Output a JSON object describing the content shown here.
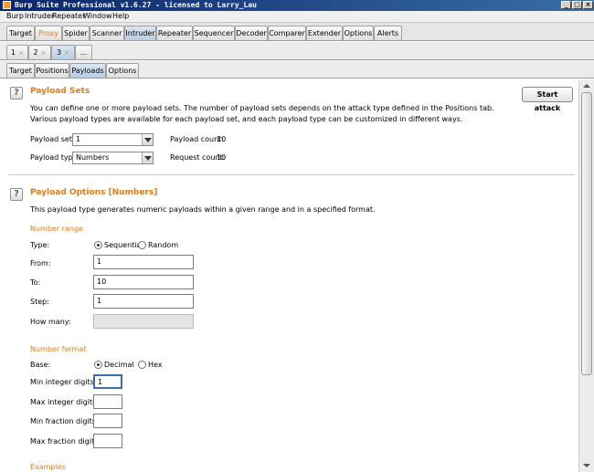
{
  "window": {
    "title": "Burp Suite Professional v1.6.27 - licensed to Larry_Lau",
    "icon": "burp-icon",
    "controls": [
      "_",
      "□",
      "×"
    ]
  },
  "menubar": [
    "Burp",
    "Intruder",
    "Repeater",
    "Window",
    "Help"
  ],
  "main_tabs": [
    "Target",
    "Proxy",
    "Spider",
    "Scanner",
    "Intruder",
    "Repeater",
    "Sequencer",
    "Decoder",
    "Comparer",
    "Extender",
    "Options",
    "Alerts"
  ],
  "main_tab_active": "Intruder",
  "proxy_tab_color": "#e07b1a",
  "attack_tabs": [
    "1",
    "2",
    "3",
    "..."
  ],
  "attack_tab_close": "×",
  "sub_tabs": [
    "Target",
    "Positions",
    "Payloads",
    "Options"
  ],
  "sub_tab_active": "Payloads",
  "payload_sets": {
    "heading": "Payload Sets",
    "description": "You can define one or more payload sets. The number of payload sets depends on the attack type defined in the Positions tab. Various payload types are available for each payload set, and each payload type can be customized in different ways.",
    "start_attack": "Start attack",
    "payload_set_label": "Payload set:",
    "payload_set_value": "1",
    "payload_type_label": "Payload type:",
    "payload_type_value": "Numbers",
    "payload_count_label": "Payload count:",
    "payload_count_value": "10",
    "request_count_label": "Request count:",
    "request_count_value": "10",
    "help_icon": "?"
  },
  "payload_options": {
    "heading": "Payload Options [Numbers]",
    "description": "This payload type generates numeric payloads within a given range and in a specified format.",
    "help_icon": "?",
    "number_range": {
      "heading": "Number range",
      "type_label": "Type:",
      "sequential": "Sequential",
      "random": "Random",
      "from_label": "From:",
      "from_value": "1",
      "to_label": "To:",
      "to_value": "10",
      "step_label": "Step:",
      "step_value": "1",
      "how_many_label": "How many:",
      "how_many_value": ""
    },
    "number_format": {
      "heading": "Number format",
      "base_label": "Base:",
      "decimal": "Decimal",
      "hex": "Hex",
      "min_int_label": "Min integer digits:",
      "min_int_value": "1",
      "max_int_label": "Max integer digits:",
      "max_int_value": "",
      "min_frac_label": "Min fraction digits:",
      "min_frac_value": "",
      "max_frac_label": "Max fraction digits:",
      "max_frac_value": ""
    },
    "examples_heading": "Examples"
  },
  "accent_color": "#e07b1a"
}
